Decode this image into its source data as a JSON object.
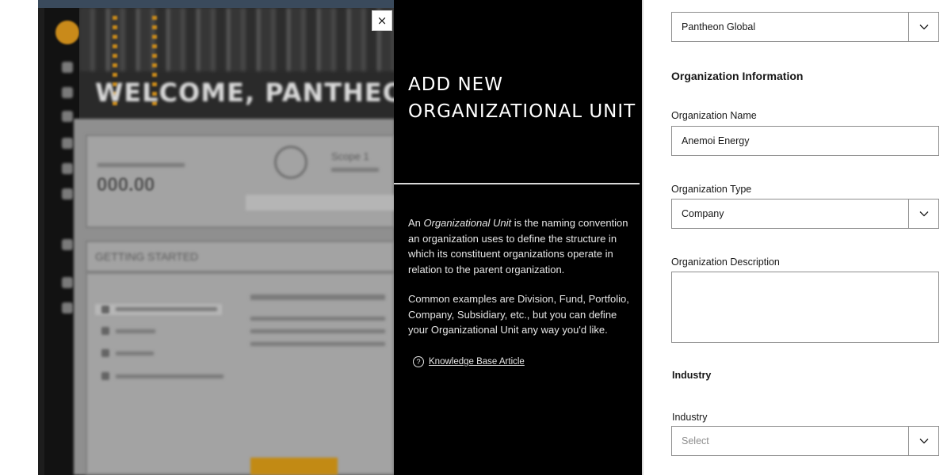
{
  "background_app": {
    "welcome": "WELCOME, PANTHEON G",
    "total_value": "000.00",
    "scope": "Scope 1",
    "getting_started": "GETTING STARTED"
  },
  "close_label": "×",
  "info_panel": {
    "title": "ADD NEW ORGANIZATIONAL UNIT",
    "para1_prefix": "An ",
    "para1_emphasis": "Organizational Unit",
    "para1_suffix": " is the naming convention an organization uses to define the structure in which its constituent organizations operate in relation to the parent organization.",
    "para2": "Common examples are Division, Fund, Portfolio, Company, Subsidiary, etc., but you can define your Organizational Unit any way you'd like.",
    "kb_icon": "?",
    "kb_link": "Knowledge Base Article"
  },
  "form": {
    "parent_org": {
      "value": "Pantheon Global"
    },
    "org_info_heading": "Organization Information",
    "org_name": {
      "label": "Organization Name",
      "value": "Anemoi Energy"
    },
    "org_type": {
      "label": "Organization Type",
      "value": "Company"
    },
    "org_description": {
      "label": "Organization Description"
    },
    "industry_heading": "Industry",
    "industry": {
      "label": "Industry",
      "placeholder": "Select"
    }
  },
  "icons": {
    "close": "close-icon",
    "chevron": "chevron-down-icon",
    "help": "question-circle-icon"
  },
  "colors": {
    "panel_black": "#000000",
    "text_primary": "#161616",
    "border": "#8d8d8d",
    "accent_gold": "#c98a1a"
  }
}
